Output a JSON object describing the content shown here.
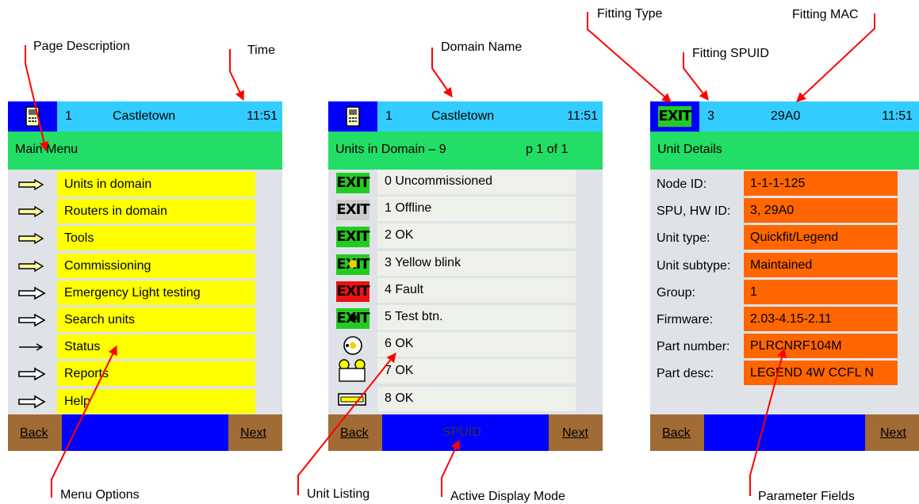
{
  "callouts": {
    "page_description": "Page Description",
    "time": "Time",
    "domain_name": "Domain Name",
    "fitting_type": "Fitting Type",
    "fitting_mac": "Fitting MAC",
    "fitting_spuid": "Fitting SPUID",
    "menu_options": "Menu Options",
    "unit_listing": "Unit Listing",
    "active_display_mode": "Active Display Mode",
    "parameter_fields": "Parameter Fields"
  },
  "screen1": {
    "num": "1",
    "domain": "Castletown",
    "time": "11:51",
    "title": "Main Menu",
    "menu": [
      "Units in domain",
      "Routers in domain",
      "Tools",
      "Commissioning",
      "Emergency Light testing",
      "Search units",
      "Status",
      "Reports",
      "Help"
    ],
    "back": "Back",
    "next": "Next"
  },
  "screen2": {
    "num": "1",
    "domain": "Castletown",
    "time": "11:51",
    "title": "Units in Domain – 9",
    "page": "p 1 of 1",
    "units": [
      "0 Uncommissioned",
      "1 Offline",
      "2 OK",
      "3 Yellow blink",
      "4 Fault",
      "5 Test btn.",
      "6 OK",
      "7 OK",
      "8 OK"
    ],
    "exit_text": "EXIT",
    "back": "Back",
    "mode": "SPUID",
    "next": "Next"
  },
  "screen3": {
    "fitting_type": "EXIT",
    "spuid": "3",
    "mac": "29A0",
    "time": "11:51",
    "title": "Unit Details",
    "fields": [
      {
        "label": "Node ID:",
        "value": "1-1-1-125"
      },
      {
        "label": "SPU, HW ID:",
        "value": "3, 29A0"
      },
      {
        "label": "Unit type:",
        "value": "Quickfit/Legend"
      },
      {
        "label": "Unit subtype:",
        "value": "Maintained"
      },
      {
        "label": "Group:",
        "value": "1"
      },
      {
        "label": "Firmware:",
        "value": "2.03-4.15-2.11"
      },
      {
        "label": "Part number:",
        "value": "PLRCNRF104M"
      },
      {
        "label": "Part desc:",
        "value": "LEGEND 4W CCFL N"
      }
    ],
    "back": "Back",
    "next": "Next"
  },
  "colors": {
    "header": "#33ccff",
    "subheader": "#22dd66",
    "menu": "#ffff00",
    "param": "#ff6600",
    "footer": "#0000ff",
    "button": "#a06b35",
    "arrow": "#ff0000"
  }
}
